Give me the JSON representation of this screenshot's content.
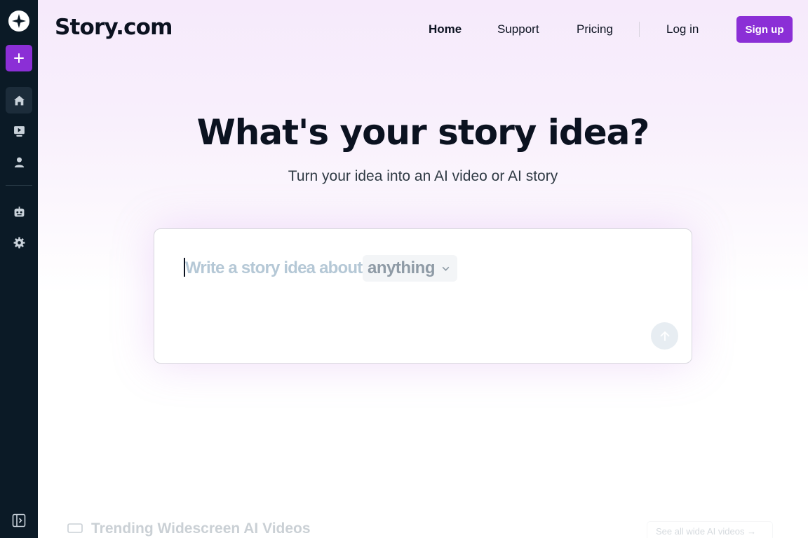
{
  "colors": {
    "accent": "#8b2fd6",
    "sidebar_bg": "#0b1a26",
    "text_dark": "#0b1220"
  },
  "sidebar": {
    "logo_icon": "compass-star-icon",
    "new_button_icon": "plus-icon",
    "items": [
      {
        "icon": "home-icon",
        "active": true
      },
      {
        "icon": "video-library-icon",
        "active": false
      },
      {
        "icon": "user-icon",
        "active": false
      },
      {
        "icon": "robot-icon",
        "active": false
      },
      {
        "icon": "gear-icon",
        "active": false
      }
    ],
    "collapse_icon": "sidebar-toggle-icon"
  },
  "header": {
    "brand": "Story.com",
    "nav": {
      "home": "Home",
      "support": "Support",
      "pricing": "Pricing",
      "login": "Log in"
    },
    "signup_label": "Sign up"
  },
  "hero": {
    "title": "What's your story idea?",
    "subtitle": "Turn your idea into an AI video or AI story"
  },
  "prompt": {
    "placeholder": "Write a story idea about",
    "topic_value": "anything",
    "send_icon": "arrow-up-icon"
  },
  "trending": {
    "title": "Trending Widescreen AI Videos",
    "see_all": "See all wide AI videos →",
    "icon": "widescreen-icon"
  }
}
